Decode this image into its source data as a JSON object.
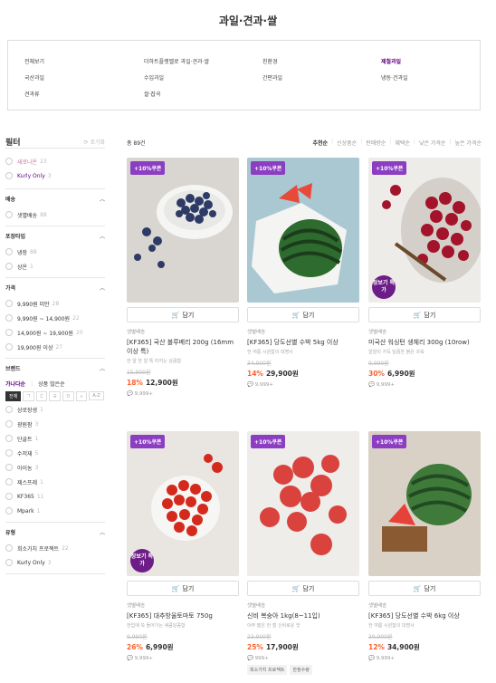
{
  "page_title": "과일·견과·쌀",
  "categories": [
    {
      "label": "전체보기",
      "active": false
    },
    {
      "label": "더하트플랫벨로 과일·견과·쌀",
      "active": false
    },
    {
      "label": "친환경",
      "active": false
    },
    {
      "label": "제철과일",
      "active": true
    },
    {
      "label": "국산과일",
      "active": false
    },
    {
      "label": "수입과일",
      "active": false
    },
    {
      "label": "간편과일",
      "active": false
    },
    {
      "label": "냉동·건과일",
      "active": false
    },
    {
      "label": "견과류",
      "active": false
    },
    {
      "label": "쌀·잡곡",
      "active": false
    }
  ],
  "filter": {
    "title": "필터",
    "reset": "초기화",
    "top_options": [
      {
        "label": "새로나온",
        "count": "23",
        "color": "#d56e9e"
      },
      {
        "label": "Kurly Only",
        "count": "3",
        "color": "#5f0080"
      }
    ],
    "sections": [
      {
        "title": "배송",
        "options": [
          {
            "label": "샛별배송",
            "count": "88"
          }
        ]
      },
      {
        "title": "포장타입",
        "options": [
          {
            "label": "냉장",
            "count": "88"
          },
          {
            "label": "상온",
            "count": "1"
          }
        ]
      },
      {
        "title": "가격",
        "options": [
          {
            "label": "9,990원 미만",
            "count": "28"
          },
          {
            "label": "9,990원 ~ 14,900원",
            "count": "22"
          },
          {
            "label": "14,900원 ~ 19,900원",
            "count": "20"
          },
          {
            "label": "19,900원 이상",
            "count": "27"
          }
        ]
      }
    ],
    "brand": {
      "title": "브랜드",
      "tab_abc": "가나다순",
      "tab_count": "상품 많은순",
      "alpha": [
        "전체",
        "ㄱ",
        "ㄷ",
        "ㄹ",
        "ㅁ",
        "ㅅ",
        "A-Z"
      ],
      "options": [
        {
          "label": "상로장생",
          "count": "1"
        },
        {
          "label": "광원팜",
          "count": "3"
        },
        {
          "label": "단골트",
          "count": "1"
        },
        {
          "label": "수저재",
          "count": "5"
        },
        {
          "label": "아이농",
          "count": "3"
        },
        {
          "label": "제스프레",
          "count": "1"
        },
        {
          "label": "KF365",
          "count": "11"
        },
        {
          "label": "Mpark",
          "count": "1"
        }
      ]
    },
    "type_section": {
      "title": "유형",
      "options": [
        {
          "label": "희소가치 프로젝트",
          "count": "22"
        },
        {
          "label": "Kurly Only",
          "count": "3"
        }
      ]
    }
  },
  "toolbar": {
    "total": "총 89건",
    "sorts": [
      "추천순",
      "신상품순",
      "판매량순",
      "혜택순",
      "낮은 가격순",
      "높은 가격순"
    ]
  },
  "cart_label": "담기",
  "jangbogi": "장보기 특가",
  "products": [
    {
      "coupon": "+10%쿠폰",
      "delivery": "샛별배송",
      "name": "[KF365] 국산 블루베리 200g (16mm이상 특)",
      "desc": "한 알 한 알 톡 터지는 상큼함",
      "orig": "15,900원",
      "disc": "18%",
      "price": "12,900원",
      "reviews": "9,999+",
      "jang": false,
      "tags": []
    },
    {
      "coupon": "+10%쿠폰",
      "delivery": "샛별배송",
      "name": "[KF365] 당도선별 수박 5kg 이상",
      "desc": "한 여름 시원함의 대명사",
      "orig": "34,900원",
      "disc": "14%",
      "price": "29,900원",
      "reviews": "9,999+",
      "jang": false,
      "tags": []
    },
    {
      "coupon": "+10%쿠폰",
      "delivery": "샛별배송",
      "name": "미국산 워싱턴 생체리 300g (10row)",
      "desc": "알알이 가득 달콤한 붉은 과육",
      "orig": "9,990원",
      "disc": "30%",
      "price": "6,990원",
      "reviews": "9,999+",
      "jang": true,
      "tags": []
    },
    {
      "coupon": "+10%쿠폰",
      "delivery": "샛별배송",
      "name": "[KF365] 대추방울토마토 750g",
      "desc": "한입에 쏙 들어가는 새콤달콤함",
      "orig": "9,990원",
      "disc": "26%",
      "price": "6,990원",
      "reviews": "9,999+",
      "jang": true,
      "tags": []
    },
    {
      "coupon": "+10%쿠폰",
      "delivery": "샛별배송",
      "name": "신비 복숭아 1kg(8~11입)",
      "desc": "아주 짧은 한 철 신비로운 맛",
      "orig": "23,900원",
      "disc": "25%",
      "price": "17,900원",
      "reviews": "999+",
      "jang": false,
      "tags": [
        "희소가치 프로젝트",
        "한정수량"
      ]
    },
    {
      "coupon": "+10%쿠폰",
      "delivery": "샛별배송",
      "name": "[KF365] 당도선별 수박 6kg 이상",
      "desc": "한 여름 시원함의 대명사",
      "orig": "39,900원",
      "disc": "12%",
      "price": "34,900원",
      "reviews": "9,999+",
      "jang": false,
      "tags": []
    }
  ],
  "colors": {
    "purple": "#5f0080",
    "discount": "#fa622f",
    "coupon": "#8c3ec2"
  }
}
